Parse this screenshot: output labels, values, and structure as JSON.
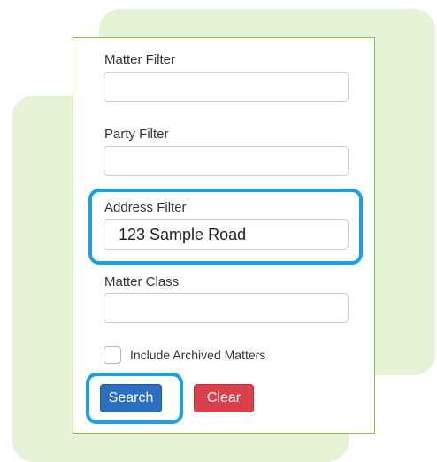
{
  "filters": {
    "matter": {
      "label": "Matter Filter",
      "value": ""
    },
    "party": {
      "label": "Party Filter",
      "value": ""
    },
    "address": {
      "label": "Address Filter",
      "value": "123 Sample Road"
    },
    "matter_class": {
      "label": "Matter Class",
      "value": ""
    }
  },
  "include_archived": {
    "label": "Include Archived Matters",
    "checked": false
  },
  "buttons": {
    "search": "Search",
    "clear": "Clear"
  },
  "colors": {
    "highlight": "#1aa0e8",
    "search_button": "#2a6fc0",
    "clear_button": "#d9404a",
    "card_border": "#8cc152",
    "background_blob": "#e4f2d6"
  }
}
